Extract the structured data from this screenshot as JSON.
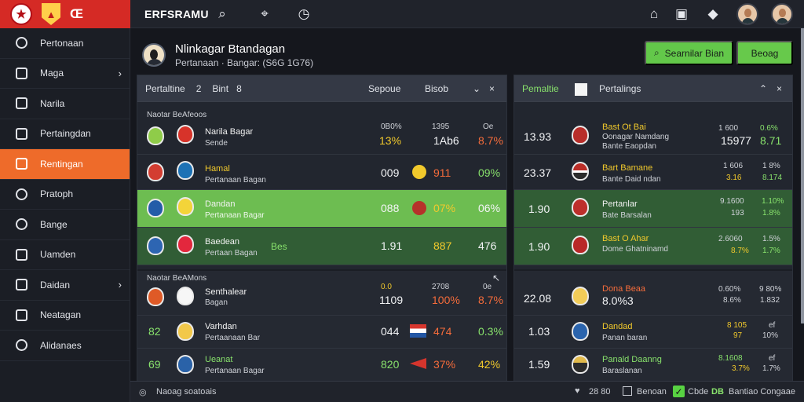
{
  "top": {
    "brand_mark": "Œ",
    "title": "ERFSRAMU"
  },
  "sidebar": {
    "items": [
      {
        "label": "Pertonaan"
      },
      {
        "label": "Maga"
      },
      {
        "label": "Narila"
      },
      {
        "label": "Pertaingdan"
      },
      {
        "label": "Rentingan"
      },
      {
        "label": "Pratoph"
      },
      {
        "label": "Bange"
      },
      {
        "label": "Uamden"
      },
      {
        "label": "Daidan"
      },
      {
        "label": "Neatagan"
      },
      {
        "label": "Alidanaes"
      }
    ]
  },
  "profile": {
    "name": "Nlinkagar Btandagan",
    "sub": "Pertanaan · Bangar: (S6G 1G76)"
  },
  "buttons": {
    "search": "Searnilar Bian",
    "login": "Beoag"
  },
  "left_panel": {
    "head_left": "Pertaltine",
    "head_num": "2",
    "head_mid": "Bint",
    "head_num2": "8",
    "head_right": "Sepoue",
    "head_extra": "Bisob",
    "section_a": "Naotar BeAfeoos",
    "section_b": "Naotar BeAMons",
    "rows": [
      {
        "team": "Narila Bagar",
        "sub": "Sende",
        "a": "0B0%",
        "b": "1395",
        "c": "13%",
        "d": "1Ab6",
        "e": "Oe",
        "f": "8.7%"
      },
      {
        "team": "Hamal",
        "sub": "Pertanaan Bagan",
        "a": "009",
        "b": "911",
        "c": "09%"
      },
      {
        "team": "Dandan",
        "sub": "Pertanaan Bagar",
        "a": "088",
        "b": "07%",
        "c": "06%"
      },
      {
        "team": "Baedean",
        "sub": "Pertaan Bagan",
        "a": "1.91",
        "b": "887",
        "c": "476",
        "tag": "Bes"
      },
      {
        "team": "Senthalear",
        "sub": "Bagan",
        "a": "1109",
        "b": "100%",
        "c": "8.7%",
        "top_a": "0.0",
        "top_b": "2708",
        "top_c": "0e"
      },
      {
        "team": "Varhdan",
        "sub": "Pertaanaan Bar",
        "left": "82",
        "a": "044",
        "b": "474",
        "c": "0.3%"
      },
      {
        "team": "Ueanat",
        "sub": "Pertanaan Bagar",
        "left": "69",
        "a": "820",
        "b": "37%",
        "c": "42%"
      }
    ]
  },
  "right_panel": {
    "head_left": "Pemaltie",
    "head_right": "Pertalings",
    "rows": [
      {
        "left": "13.93",
        "team": "Bast Ot Bai",
        "sub": "Oonagar Namdang",
        "sub2": "Bante Eaopdan",
        "a": "1 600",
        "b": "15977",
        "c": "0.6%",
        "d": "8.71"
      },
      {
        "left": "23.37",
        "team": "Bart Bamane",
        "sub": "Bante Daid ndan",
        "a": "1 606",
        "b": "3.16",
        "c": "1 8%",
        "d": "8.174"
      },
      {
        "left": "1.90",
        "team": "Pertanlar",
        "sub": "Bate Barsalan",
        "a": "9.1600",
        "b": "193",
        "c": "1.10%",
        "d": "1.8%"
      },
      {
        "left": "1.90",
        "team": "Bast O Ahar",
        "sub": "Dome Ghatninamd",
        "a": "2.6060",
        "b": "8.7%",
        "c": "1.5%",
        "d": "1.7%"
      },
      {
        "left": "22.08",
        "team": "Dona Beaa",
        "sub": "8.0%3",
        "a": "0.60%",
        "b": "8.6%",
        "c": "9 80%",
        "d": "1.832"
      },
      {
        "left": "1.03",
        "team": "Dandad",
        "sub": "Panan baran",
        "a": "8 105",
        "b": "97",
        "c": "ef",
        "d": "10%"
      },
      {
        "left": "1.59",
        "team": "Panald Daanng",
        "sub": "Baraslanan",
        "a": "8.1608",
        "b": "3.7%",
        "c": "ef",
        "d": "1.7%"
      }
    ]
  },
  "footer": {
    "left": "Naoag soatoais",
    "r1": "28 80",
    "r2": "Benoan",
    "r3": "Cbde",
    "r4": "DB",
    "r5": "Bantiao Congaae"
  },
  "colors": {
    "accent": "#ee6b2a",
    "green": "#6dbd51",
    "red": "#d52a25"
  }
}
